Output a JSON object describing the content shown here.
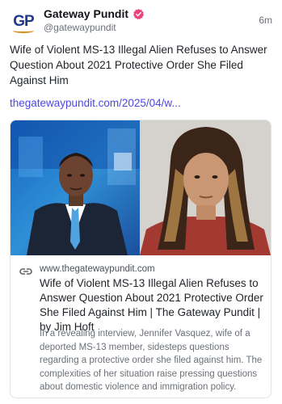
{
  "account": {
    "avatar_text": "GP",
    "display_name": "Gateway Pundit",
    "handle": "@gatewaypundit",
    "timestamp": "6m"
  },
  "post": {
    "text": "Wife of Violent MS-13 Illegal Alien Refuses to Answer Question About 2021 Protective Order She Filed Against Him",
    "link": "thegatewaypundit.com/2025/04/w..."
  },
  "card": {
    "domain": "www.thegatewaypundit.com",
    "title": "Wife of Violent MS-13 Illegal Alien Refuses to Answer Question About 2021 Protective Order She Filed Against Him | The Gateway Pundit | by Jim Hoft",
    "description": "In a revealing interview, Jennifer Vasquez, wife of a deported MS-13 member, sidesteps questions regarding a protective order she filed against him. The complexities of her situation raise pressing questions about domestic violence and immigration policy."
  },
  "colors": {
    "link": "#4f46e5",
    "verified_badge": "#e8437a",
    "avatar_brand": "#1e3a8a"
  },
  "icons": {
    "verified": "verified-badge-icon",
    "link": "link-icon"
  }
}
